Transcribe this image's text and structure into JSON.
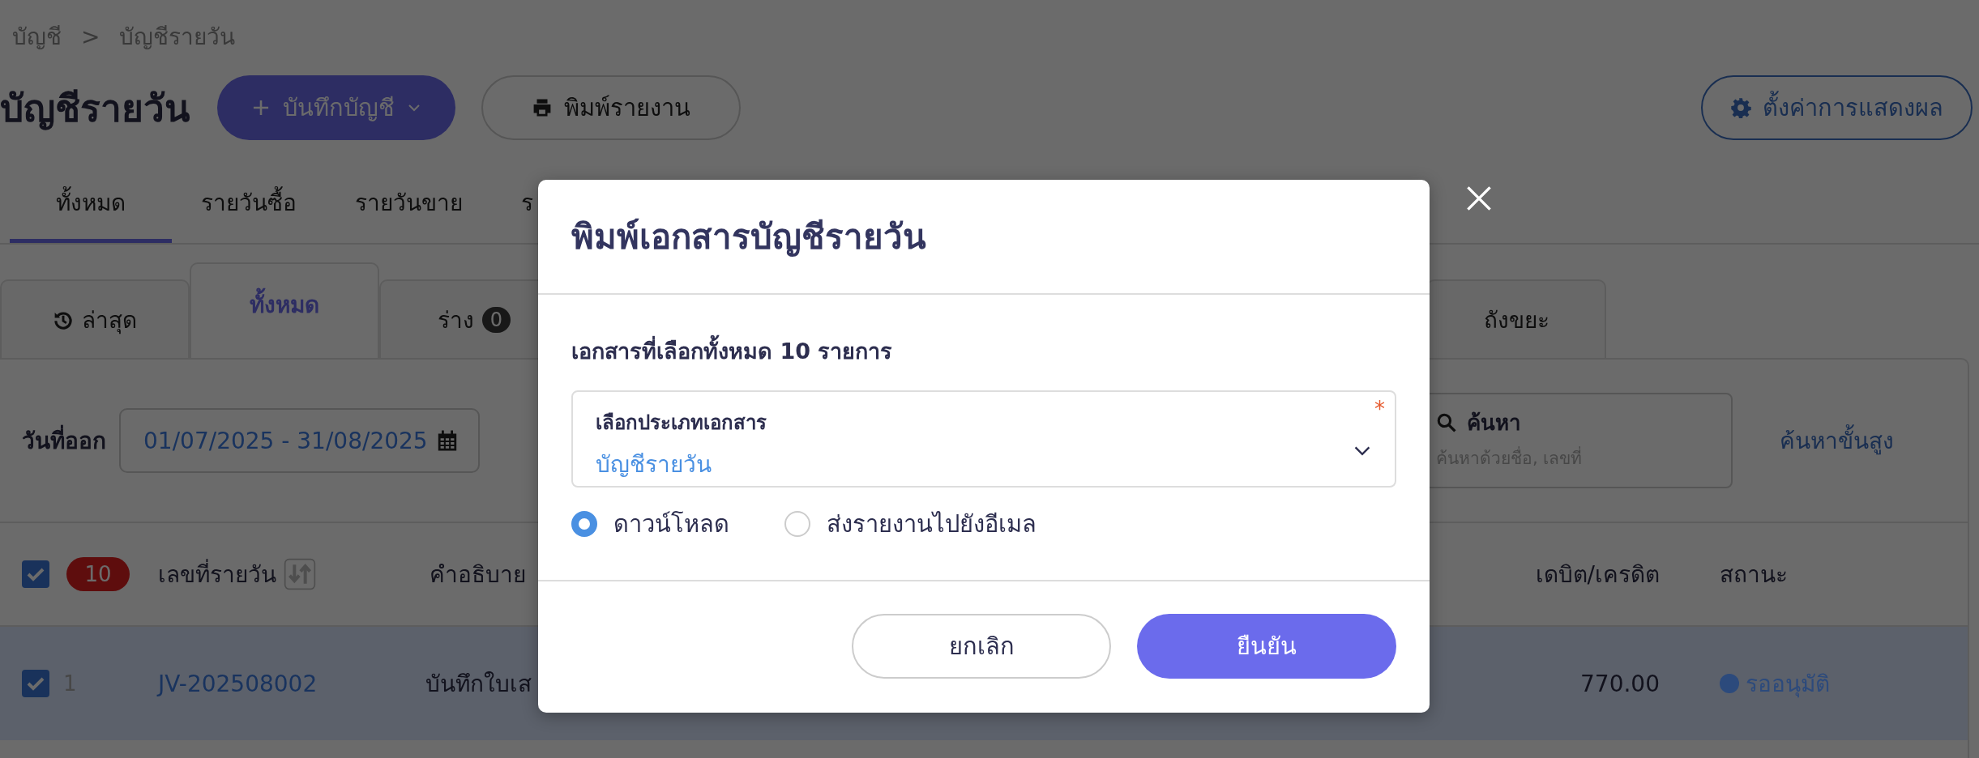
{
  "breadcrumb": {
    "items": [
      "บัญชี",
      "บัญชีรายวัน"
    ],
    "separator": ">"
  },
  "page_title": "บัญชีรายวัน",
  "actions": [
    {
      "label": "บันทึกบัญชี",
      "kind": "primary"
    },
    {
      "label": "พิมพ์รายงาน",
      "kind": "print"
    }
  ],
  "settings_button": "ตั้งค่าการแสดงผล",
  "category_tabs": [
    {
      "label": "ทั้งหมด",
      "selected": true
    },
    {
      "label": "รายวันซื้อ",
      "selected": false
    },
    {
      "label": "รายวันขาย",
      "selected": false
    },
    {
      "label": "ร",
      "selected": false
    }
  ],
  "status_tabs": [
    {
      "label": "ล่าสุด",
      "kind": "history",
      "selected": false
    },
    {
      "label": "ทั้งหมด",
      "kind": "plain",
      "selected": true
    },
    {
      "label": "ร่าง",
      "kind": "count",
      "count": "0",
      "selected": false
    },
    {
      "label": "ถังขยะ",
      "kind": "trash",
      "selected": false
    }
  ],
  "filters": {
    "date_label": "วันที่ออก",
    "date_range": "01/07/2025 - 31/08/2025",
    "search_label": "ค้นหา",
    "search_placeholder": "ค้นหาด้วยชื่อ, เลขที่",
    "advanced_link": "ค้นหาขั้นสูง"
  },
  "table": {
    "select_all_checked": true,
    "selected_count": "10",
    "columns": [
      "เลขที่รายวัน",
      "คำอธิบาย",
      "เดบิต/เครดิต",
      "สถานะ"
    ],
    "rows": [
      {
        "checked": true,
        "selected": true,
        "index": "1",
        "number": "JV-202508002",
        "description": "บันทึกใบเส",
        "amount": "770.00",
        "status": "รออนุมัติ",
        "color": "#2c4a7c"
      }
    ]
  },
  "modal": {
    "title": "พิมพ์เอกสารบัญชีรายวัน",
    "summary": "เอกสารที่เลือกทั้งหมด 10 รายการ",
    "select_label": "เลือกประเภทเอกสาร",
    "required": true,
    "required_mark": "*",
    "select_value": "บัญชีรายวัน",
    "options": [
      {
        "label": "ดาวน์โหลด",
        "selected": true
      },
      {
        "label": "ส่งรายงานไปยังอีเมล",
        "selected": false
      }
    ],
    "cancel": "ยกเลิก",
    "confirm": "ยืนยัน"
  }
}
